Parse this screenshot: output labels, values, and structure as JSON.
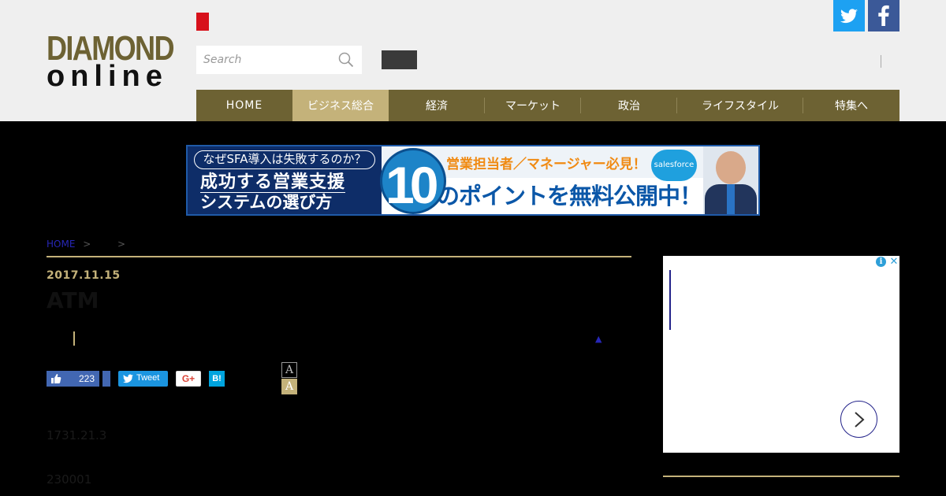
{
  "logo": {
    "top": "DIAMOND",
    "bottom": "online"
  },
  "search": {
    "placeholder": "Search"
  },
  "nav": {
    "items": [
      {
        "label": "HOME"
      },
      {
        "label": "ビジネス総合"
      },
      {
        "label": "経済"
      },
      {
        "label": "マーケット"
      },
      {
        "label": "政治"
      },
      {
        "label": "ライフスタイル"
      },
      {
        "label": "特集へ"
      }
    ]
  },
  "banner": {
    "pill": "なぜSFA導入は失敗するのか？",
    "line1": "成功する営業支援",
    "line2": "システムの選び方",
    "number": "10",
    "top_text": "営業担当者／マネージャー必見！",
    "main_text": "のポイントを無料公開中！",
    "brand": "salesforce"
  },
  "article": {
    "breadcrumb_home": "HOME",
    "breadcrumb_sep": ">",
    "date": "2017.11.15",
    "title": "ATM",
    "like_count": "223",
    "tweet_label": "Tweet",
    "gplus_label": "G+",
    "hatena_label": "B!",
    "font_small": "A",
    "font_large": "A",
    "tiny_arrow": "▲",
    "paragraph1": "1731.21.3",
    "paragraph2": "230001"
  },
  "colors": {
    "brand_gold": "#6d6233",
    "accent_gold": "#c4b27a",
    "twitter": "#1da1f2",
    "facebook": "#3b5998"
  }
}
